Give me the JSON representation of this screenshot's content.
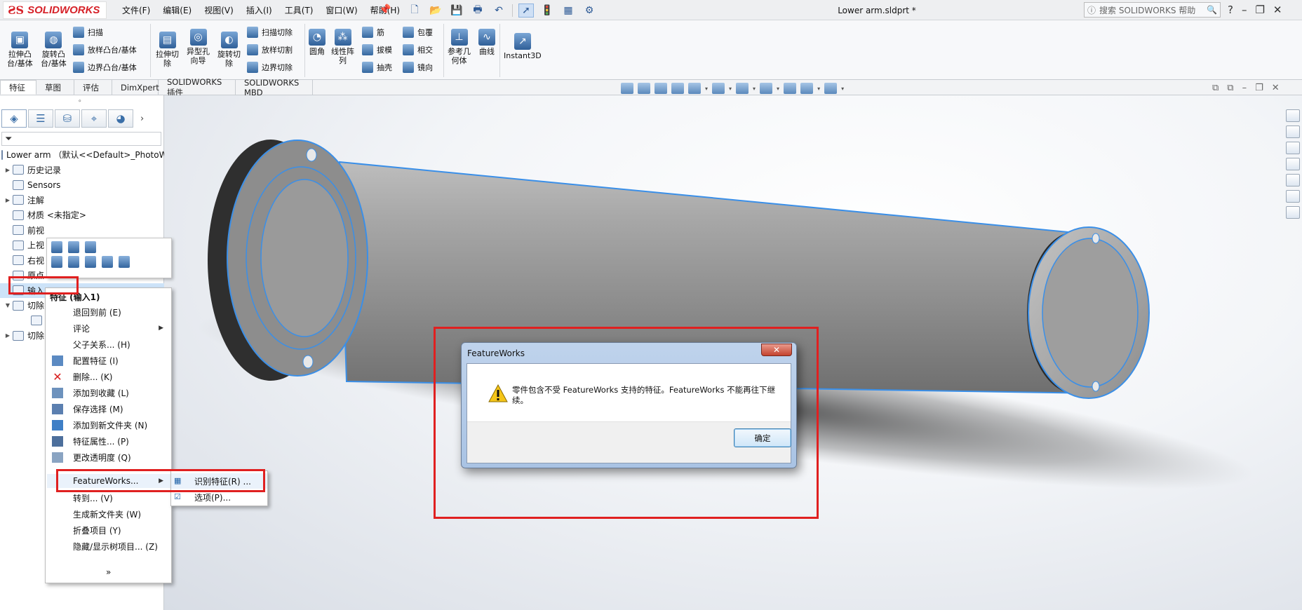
{
  "app": {
    "logo_mark": "ƧS",
    "logo_text": "SOLIDWORKS",
    "menu": [
      "文件(F)",
      "编辑(E)",
      "视图(V)",
      "插入(I)",
      "工具(T)",
      "窗口(W)",
      "帮助(H)"
    ],
    "document_title": "Lower arm.sldprt *",
    "help_search_placeholder": "搜索 SOLIDWORKS 帮助",
    "window_controls": [
      "?",
      "–",
      "❐",
      "✕"
    ]
  },
  "ribbon": {
    "extrude_boss": "拉伸凸\n台/基体",
    "revolve_boss": "旋转凸\n台/基体",
    "sweep": "扫描",
    "loft_boss": "放样凸台/基体",
    "boundary_boss": "边界凸台/基体",
    "extrude_cut": "拉伸切\n除",
    "hole_wizard": "异型孔\n向导",
    "revolve_cut": "旋转切\n除",
    "swept_cut": "扫描切除",
    "lofted_cut": "放样切割",
    "boundary_cut": "边界切除",
    "fillet": "圆角",
    "linear_pattern": "线性阵\n列",
    "rib": "筋",
    "draft": "拔模",
    "shell": "抽壳",
    "wrap": "包覆",
    "intersect": "相交",
    "mirror": "镜向",
    "reference_geometry": "参考几\n何体",
    "curves": "曲线",
    "instant3d": "Instant3D"
  },
  "tabs": [
    "特征",
    "草图",
    "评估",
    "DimXpert",
    "SOLIDWORKS 插件",
    "SOLIDWORKS MBD"
  ],
  "tree": {
    "root": "Lower arm （默认<<Default>_PhotoW",
    "items": [
      "历史记录",
      "Sensors",
      "注解",
      "材质 <未指定>",
      "前视",
      "上视",
      "右视",
      "原点",
      "输入",
      "切除",
      "",
      "切除"
    ]
  },
  "context_menu": {
    "header": "特征 (输入1)",
    "items": [
      "退回到前 (E)",
      "评论",
      "父子关系... (H)",
      "配置特征 (I)",
      "删除... (K)",
      "添加到收藏 (L)",
      "保存选择 (M)",
      "添加到新文件夹 (N)",
      "特征属性... (P)",
      "更改透明度 (Q)",
      "FeatureWorks...",
      "转到... (V)",
      "生成新文件夹 (W)",
      "折叠项目 (Y)",
      "隐藏/显示树项目... (Z)",
      "»"
    ]
  },
  "submenu": {
    "items": [
      "识别特征(R) ...",
      "选项(P)..."
    ]
  },
  "dialog": {
    "title": "FeatureWorks",
    "close": "✕",
    "message": "零件包含不受 FeatureWorks 支持的特征。FeatureWorks 不能再往下继续。",
    "ok_button": "确定"
  },
  "colors": {
    "accent_red": "#e02020",
    "selection_blue": "#3a8fe8",
    "logo_red": "#d62128"
  }
}
